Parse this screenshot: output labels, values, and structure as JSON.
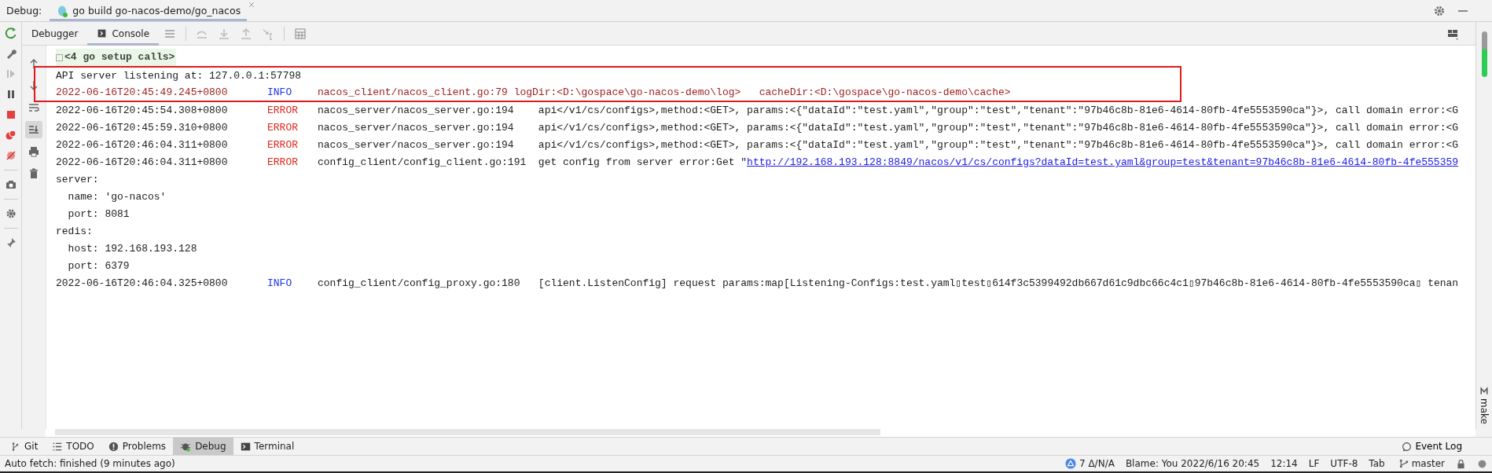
{
  "debug_bar": {
    "label": "Debug:",
    "tabs": [
      {
        "title": "go build go-nacos-demo/go_nacos",
        "selected": true
      }
    ]
  },
  "toolbar": {
    "tabs": [
      {
        "label": "Debugger",
        "selected": false
      },
      {
        "label": "Console",
        "selected": true
      }
    ]
  },
  "scroll_to_end": {
    "on": true
  },
  "console": {
    "lines": [
      {
        "kind": "folded",
        "text": "<4 go setup calls>",
        "highlighted": false
      },
      {
        "kind": "plain",
        "text": "API server listening at: 127.0.0.1:57798",
        "highlighted": true
      },
      {
        "kind": "stderr-log",
        "time": "2022-06-16T20:45:49.245+0800",
        "level": "INFO",
        "text": "nacos_client/nacos_client.go:79 logDir:<D:\\gospace\\go-nacos-demo\\log>   cacheDir:<D:\\gospace\\go-nacos-demo\\cache>",
        "highlighted": true
      },
      {
        "kind": "log",
        "time": "2022-06-16T20:45:54.308+0800",
        "level": "ERROR",
        "text": "nacos_server/nacos_server.go:194    api</v1/cs/configs>,method:<GET>, params:<{\"dataId\":\"test.yaml\",\"group\":\"test\",\"tenant\":\"97b46c8b-81e6-4614-80fb-4fe5553590ca\"}>, call domain error:<G",
        "highlighted": false
      },
      {
        "kind": "log",
        "time": "2022-06-16T20:45:59.310+0800",
        "level": "ERROR",
        "text": "nacos_server/nacos_server.go:194    api</v1/cs/configs>,method:<GET>, params:<{\"dataId\":\"test.yaml\",\"group\":\"test\",\"tenant\":\"97b46c8b-81e6-4614-80fb-4fe5553590ca\"}>, call domain error:<G",
        "highlighted": false
      },
      {
        "kind": "log",
        "time": "2022-06-16T20:46:04.311+0800",
        "level": "ERROR",
        "text": "nacos_server/nacos_server.go:194    api</v1/cs/configs>,method:<GET>, params:<{\"dataId\":\"test.yaml\",\"group\":\"test\",\"tenant\":\"97b46c8b-81e6-4614-80fb-4fe5553590ca\"}>, call domain error:<G",
        "highlighted": false
      },
      {
        "kind": "log",
        "time": "2022-06-16T20:46:04.311+0800",
        "level": "ERROR",
        "text": "config_client/config_client.go:191  get config from server error:Get \"",
        "link": "http://192.168.193.128:8849/nacos/v1/cs/configs?dataId=test.yaml&group=test&tenant=97b46c8b-81e6-4614-80fb-4fe555359",
        "highlighted": false
      },
      {
        "kind": "plain",
        "text": "server:",
        "highlighted": false
      },
      {
        "kind": "plain",
        "text": "  name: 'go-nacos'",
        "highlighted": false
      },
      {
        "kind": "plain",
        "text": "  port: 8081",
        "highlighted": false
      },
      {
        "kind": "plain",
        "text": "redis:",
        "highlighted": false
      },
      {
        "kind": "plain",
        "text": "  host: 192.168.193.128",
        "highlighted": false
      },
      {
        "kind": "plain",
        "text": "  port: 6379",
        "highlighted": false
      },
      {
        "kind": "log",
        "time": "2022-06-16T20:46:04.325+0800",
        "level": "INFO",
        "text": "config_client/config_proxy.go:180   [client.ListenConfig] request params:map[Listening-Configs:test.yaml▯test▯614f3c5399492db667d61c9dbc66c4c1▯97b46c8b-81e6-4614-80fb-4fe5553590ca▯ tenan",
        "highlighted": false
      }
    ]
  },
  "tool_windows": [
    {
      "label": "Git",
      "kind": "git",
      "selected": false
    },
    {
      "label": "TODO",
      "kind": "todo",
      "selected": false
    },
    {
      "label": "Problems",
      "kind": "problems",
      "selected": false
    },
    {
      "label": "Debug",
      "kind": "debug",
      "selected": true
    },
    {
      "label": "Terminal",
      "kind": "terminal",
      "selected": false
    }
  ],
  "event_log": "Event Log",
  "status_bar": {
    "message": "Auto fetch: finished (9 minutes ago)",
    "changes": "7 Δ/N/A",
    "items": [
      "Blame: You 2022/6/16 20:45",
      "12:14",
      "LF",
      "UTF-8",
      "Tab"
    ],
    "branch": "master"
  },
  "right_strip": {
    "label": "make"
  }
}
